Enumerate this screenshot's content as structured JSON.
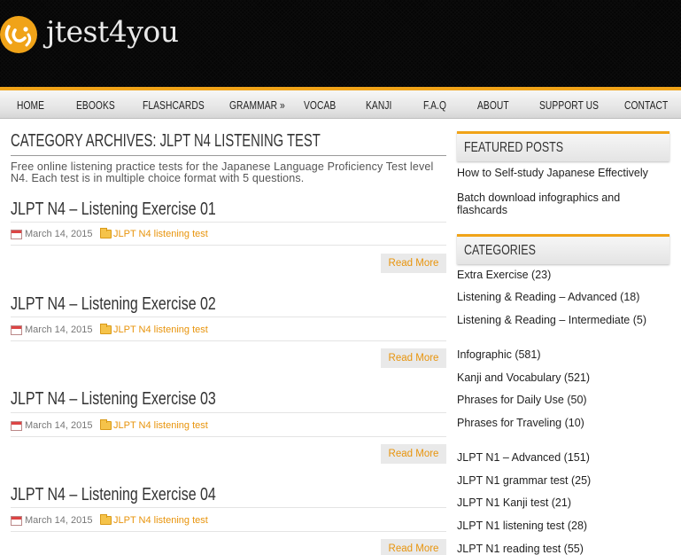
{
  "site": {
    "name": "jtest4you"
  },
  "nav": [
    {
      "label": "HOME"
    },
    {
      "label": "EBOOKS"
    },
    {
      "label": "FLASHCARDS"
    },
    {
      "label": "GRAMMAR »"
    },
    {
      "label": "VOCAB"
    },
    {
      "label": "KANJI"
    },
    {
      "label": "F.A.Q"
    },
    {
      "label": "ABOUT"
    },
    {
      "label": "SUPPORT US"
    },
    {
      "label": "CONTACT"
    }
  ],
  "archive": {
    "title": "CATEGORY ARCHIVES: JLPT N4 LISTENING TEST",
    "description": "Free online listening practice tests for the Japanese Language Proficiency Test level N4. Each test is in multiple choice format with 5 questions."
  },
  "posts": [
    {
      "title": "JLPT N4 – Listening Exercise 01",
      "date": "March 14, 2015",
      "category": "JLPT N4 listening test",
      "read_more": "Read More"
    },
    {
      "title": "JLPT N4 – Listening Exercise 02",
      "date": "March 14, 2015",
      "category": "JLPT N4 listening test",
      "read_more": "Read More"
    },
    {
      "title": "JLPT N4 – Listening Exercise 03",
      "date": "March 14, 2015",
      "category": "JLPT N4 listening test",
      "read_more": "Read More"
    },
    {
      "title": "JLPT N4 – Listening Exercise 04",
      "date": "March 14, 2015",
      "category": "JLPT N4 listening test",
      "read_more": "Read More"
    }
  ],
  "sidebar": {
    "featured": {
      "heading": "FEATURED POSTS",
      "items": [
        {
          "label": "How to Self-study Japanese Effectively"
        },
        {
          "label": "Batch download infographics and flashcards"
        }
      ]
    },
    "categories": {
      "heading": "CATEGORIES",
      "items": [
        {
          "label": "Extra Exercise (23)"
        },
        {
          "label": "Listening & Reading – Advanced (18)"
        },
        {
          "label": "Listening & Reading – Intermediate (5)"
        },
        {
          "label": "Infographic (581)"
        },
        {
          "label": "Kanji and Vocabulary (521)"
        },
        {
          "label": "Phrases for Daily Use (50)"
        },
        {
          "label": "Phrases for Traveling (10)"
        },
        {
          "label": "JLPT N1 – Advanced (151)"
        },
        {
          "label": "JLPT N1 grammar test (25)"
        },
        {
          "label": "JLPT N1 Kanji test (21)"
        },
        {
          "label": "JLPT N1 listening test (28)"
        },
        {
          "label": "JLPT N1 reading test (55)"
        }
      ]
    }
  },
  "colors": {
    "accent": "#f0a318",
    "link_orange": "#e8940c",
    "header_bg": "#050505"
  }
}
